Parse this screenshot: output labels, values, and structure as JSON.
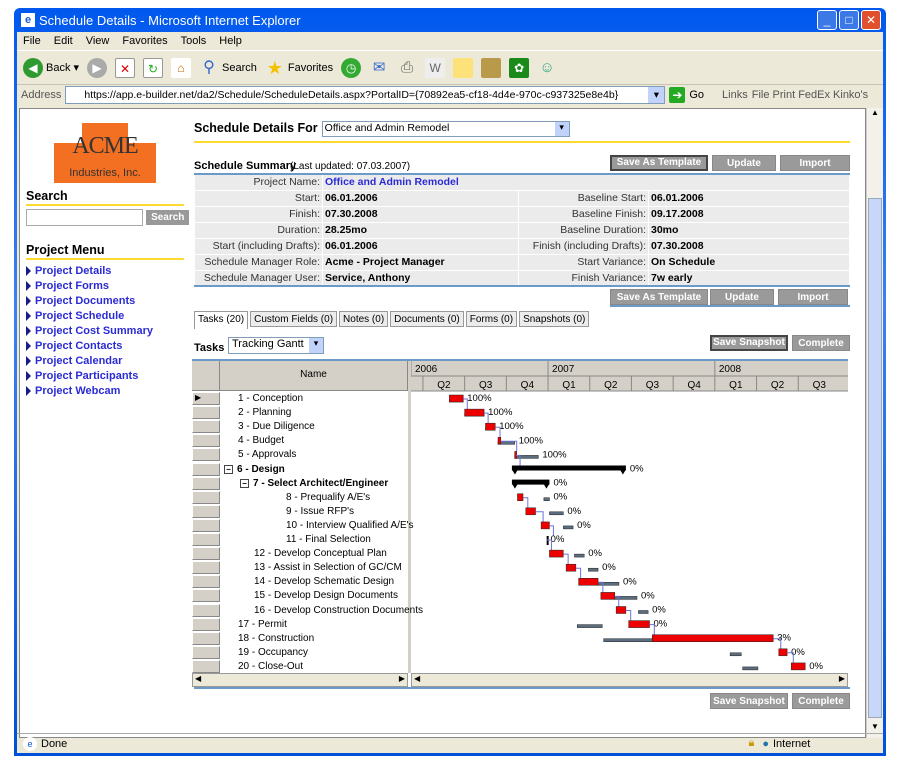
{
  "window": {
    "title": "Schedule Details - Microsoft Internet Explorer"
  },
  "menubar": [
    "File",
    "Edit",
    "View",
    "Favorites",
    "Tools",
    "Help"
  ],
  "toolbar": {
    "back": "Back",
    "search": "Search",
    "favorites": "Favorites"
  },
  "address": {
    "label": "Address",
    "url": "https://app.e-builder.net/da2/Schedule/ScheduleDetails.aspx?PortalID={70892ea5-cf18-4d4e-970c-c937325e8e4b}",
    "go": "Go",
    "links": "Links",
    "extra": "File Print FedEx Kinko's"
  },
  "status": {
    "text": "Done",
    "zone": "Internet"
  },
  "sidebar": {
    "logo_top": "ACME",
    "logo_bottom": "Industries, Inc.",
    "search_heading": "Search",
    "search_button": "Search",
    "search_value": "",
    "menu_heading": "Project Menu",
    "items": [
      "Project Details",
      "Project Forms",
      "Project Documents",
      "Project Schedule",
      "Project Cost Summary",
      "Project Contacts",
      "Project Calendar",
      "Project Participants",
      "Project Webcam"
    ]
  },
  "header": {
    "label": "Schedule Details For",
    "project": "Office and Admin Remodel"
  },
  "summary": {
    "title": "Schedule Summary",
    "updated": "(Last updated: 07.03.2007)",
    "save_template": "Save As Template",
    "update": "Update",
    "import": "Import",
    "project_name_label": "Project Name:",
    "project_name": "Office and Admin Remodel",
    "left": [
      [
        "Start:",
        "06.01.2006"
      ],
      [
        "Finish:",
        "07.30.2008"
      ],
      [
        "Duration:",
        "28.25mo"
      ],
      [
        "Start (including Drafts):",
        "06.01.2006"
      ],
      [
        "Schedule Manager Role:",
        "Acme - Project Manager"
      ],
      [
        "Schedule Manager User:",
        "Service, Anthony"
      ]
    ],
    "right": [
      [
        "Baseline Start:",
        "06.01.2006"
      ],
      [
        "Baseline Finish:",
        "09.17.2008"
      ],
      [
        "Baseline Duration:",
        "30mo"
      ],
      [
        "Finish (including Drafts):",
        "07.30.2008"
      ],
      [
        "Start Variance:",
        "On Schedule"
      ],
      [
        "Finish Variance:",
        "7w early"
      ]
    ]
  },
  "tabs": [
    "Tasks (20)",
    "Custom Fields (0)",
    "Notes (0)",
    "Documents (0)",
    "Forms (0)",
    "Snapshots (0)"
  ],
  "tasks_view": {
    "label": "Tasks",
    "view": "Tracking Gantt",
    "save_snapshot": "Save Snapshot",
    "complete": "Complete",
    "name_header": "Name"
  },
  "gantt": {
    "years": [
      {
        "label": "2006",
        "start": 0
      },
      {
        "label": "2007",
        "start": 12
      },
      {
        "label": "2008",
        "start": 24
      }
    ],
    "quarters": [
      {
        "label": "Q2",
        "start": 3
      },
      {
        "label": "Q3",
        "start": 6
      },
      {
        "label": "Q4",
        "start": 9
      },
      {
        "label": "Q1",
        "start": 12
      },
      {
        "label": "Q2",
        "start": 15
      },
      {
        "label": "Q3",
        "start": 18
      },
      {
        "label": "Q4",
        "start": 21
      },
      {
        "label": "Q1",
        "start": 24
      },
      {
        "label": "Q2",
        "start": 27
      },
      {
        "label": "Q3",
        "start": 30
      }
    ],
    "tasks": [
      {
        "name": "1 - Conception",
        "level": 0,
        "start": 4.9,
        "end": 5.9,
        "bstart": 4.9,
        "bend": 5.9,
        "pct": "100%"
      },
      {
        "name": "2 - Planning",
        "level": 0,
        "start": 6.0,
        "end": 7.4,
        "bstart": 6.0,
        "bend": 7.4,
        "pct": "100%"
      },
      {
        "name": "3 - Due Diligence",
        "level": 0,
        "start": 7.5,
        "end": 8.2,
        "bstart": 7.5,
        "bend": 8.2,
        "pct": "100%"
      },
      {
        "name": "4 - Budget",
        "level": 0,
        "start": 8.4,
        "end": 8.6,
        "bstart": 8.4,
        "bend": 9.6,
        "pct": "100%"
      },
      {
        "name": "5 - Approvals",
        "level": 0,
        "start": 9.6,
        "end": 9.7,
        "bstart": 9.6,
        "bend": 11.3,
        "pct": "100%"
      },
      {
        "name": "6 - Design",
        "level": 0,
        "summary": true,
        "start": 9.4,
        "end": 17.6,
        "pct": "0%"
      },
      {
        "name": "7 - Select Architect/Engineer",
        "level": 1,
        "summary": true,
        "start": 9.4,
        "end": 12.1,
        "pct": "0%"
      },
      {
        "name": "8 - Prequalify A/E's",
        "level": 2,
        "start": 9.8,
        "end": 10.2,
        "bstart": 11.7,
        "bend": 12.1,
        "pct": "0%"
      },
      {
        "name": "9 - Issue RFP's",
        "level": 2,
        "start": 10.4,
        "end": 11.1,
        "bstart": 12.1,
        "bend": 13.1,
        "pct": "0%"
      },
      {
        "name": "10 - Interview Qualified A/E's",
        "level": 2,
        "start": 11.5,
        "end": 12.1,
        "bstart": 13.1,
        "bend": 13.8,
        "pct": "0%"
      },
      {
        "name": "11 - Final Selection",
        "level": 2,
        "milestone": true,
        "start": 11.9,
        "end": 11.9,
        "pct": "0%"
      },
      {
        "name": "12 - Develop Conceptual Plan",
        "level": 1,
        "start": 12.1,
        "end": 13.1,
        "bstart": 13.9,
        "bend": 14.6,
        "pct": "0%"
      },
      {
        "name": "13 - Assist in Selection of GC/CM",
        "level": 1,
        "start": 13.3,
        "end": 14.0,
        "bstart": 14.9,
        "bend": 15.6,
        "pct": "0%"
      },
      {
        "name": "14 - Develop Schematic Design",
        "level": 1,
        "start": 14.2,
        "end": 15.6,
        "bstart": 15.6,
        "bend": 17.1,
        "pct": "0%"
      },
      {
        "name": "15 - Develop Design Documents",
        "level": 1,
        "start": 15.8,
        "end": 16.8,
        "bstart": 16.8,
        "bend": 18.4,
        "pct": "0%"
      },
      {
        "name": "16 - Develop Construction Documents",
        "level": 1,
        "start": 16.9,
        "end": 17.6,
        "bstart": 18.5,
        "bend": 19.2,
        "pct": "0%"
      },
      {
        "name": "17 - Permit",
        "level": 0,
        "start": 17.8,
        "end": 19.3,
        "bstart": 14.1,
        "bend": 15.9,
        "pct": "0%"
      },
      {
        "name": "18 - Construction",
        "level": 0,
        "start": 19.5,
        "end": 28.2,
        "bstart": 16.0,
        "bend": 25.0,
        "pct": "3%"
      },
      {
        "name": "19 - Occupancy",
        "level": 0,
        "start": 28.6,
        "end": 29.2,
        "bstart": 25.1,
        "bend": 25.9,
        "pct": "0%"
      },
      {
        "name": "20 - Close-Out",
        "level": 0,
        "start": 29.5,
        "end": 30.5,
        "bstart": 26.0,
        "bend": 27.1,
        "pct": "0%"
      }
    ]
  },
  "colors": {
    "accent": "#ffd92e",
    "link": "#2b2bd6",
    "bar": "#ee0000",
    "baseline": "#5a6e80",
    "rule": "#6b9ac8"
  }
}
